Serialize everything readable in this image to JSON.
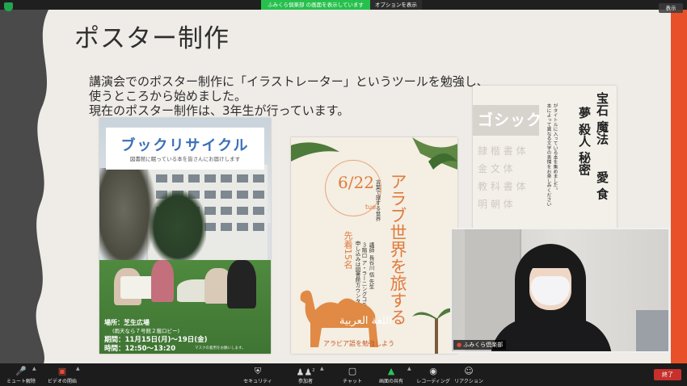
{
  "window": {
    "share_banner": "ふみくら倶楽部 の画面を表示しています",
    "share_options": "オプションを表示",
    "view_button": "表示"
  },
  "slide": {
    "title": "ポスター制作",
    "lines": [
      "講演会でのポスター制作に「イラストレーター」というツールを勉強し、",
      "使うところから始めました。",
      "現在のポスター制作は、3年生が行っています。"
    ]
  },
  "poster1": {
    "title": "ブックリサイクル",
    "subtitle": "図書館に眠っている本を皆さんにお届けします",
    "place_label": "場所：芝生広場",
    "place_note": "(雨天なら７号館２階ロビー)",
    "period": "期間：11月15日(月)～19日(金)",
    "time": "時間：12:50～13:20",
    "note": "マスクの着用をお願いします。"
  },
  "poster2": {
    "date": "6/22",
    "day": "tue",
    "headline": "アラブ世界を旅する",
    "subhead": "言葉で旅する世界",
    "speaker": "講師 長谷川 悟 先生",
    "venue": "３階口 ア・ラーニングコモンズ",
    "apply": "申し込みは図書館カウンターにて",
    "capacity": "先着15名",
    "arabic": "اللغة العربية",
    "bottom": "アラビア語を勉強しよう"
  },
  "poster3": {
    "gothic": "ゴシック",
    "left_col": [
      "隷 楷 書 体",
      "金 文 体",
      "教 科 書 体",
      "明 朝 体"
    ],
    "row1": "宝石 魔法",
    "row2": "夢 殺人 秘密",
    "row3": "愛 食",
    "desc1": "がタイトルに入っている本を集めました。",
    "desc2": "本によって異なる文字の表情をお楽しみください"
  },
  "webcam": {
    "name": "ふみくら倶楽部"
  },
  "toolbar": {
    "items": [
      {
        "label": "ミュート解除"
      },
      {
        "label": "ビデオの開始"
      },
      {
        "label": "セキュリティ"
      },
      {
        "label": "参加者"
      },
      {
        "label": "チャット"
      },
      {
        "label": "画面の共有"
      },
      {
        "label": "レコーディング"
      },
      {
        "label": "リアクション"
      }
    ],
    "participants_count": "2",
    "end": "終了"
  },
  "colors": {
    "accent_orange": "#e8502a",
    "share_green": "#27c04d",
    "end_red": "#c7302d"
  }
}
